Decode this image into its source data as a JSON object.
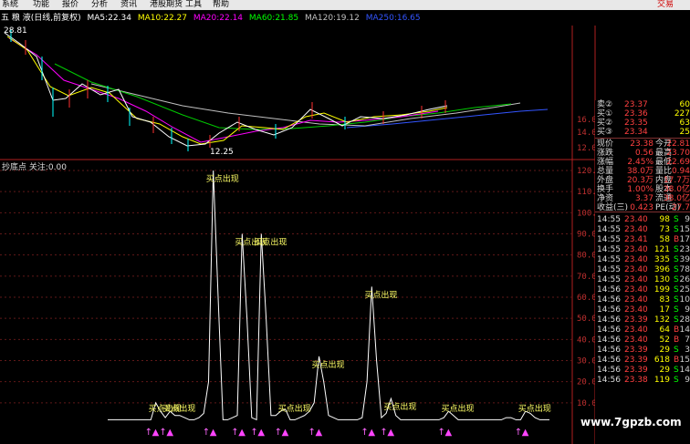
{
  "menu": {
    "items": [
      "系统",
      "功能",
      "报价",
      "分析",
      "资讯",
      "港股期货",
      "工具",
      "帮助"
    ],
    "trade": "交易"
  },
  "stock": {
    "title": "五 粮 液(日线,前复权)"
  },
  "ma_legend": [
    {
      "label": "MA5:22.34",
      "color": "#ffffff"
    },
    {
      "label": "MA10:22.27",
      "color": "#ffff00"
    },
    {
      "label": "MA20:22.14",
      "color": "#ff00ff"
    },
    {
      "label": "MA60:21.85",
      "color": "#00ff00"
    },
    {
      "label": "MA120:19.12",
      "color": "#c0c0c0"
    },
    {
      "label": "MA250:16.65",
      "color": "#3355ff"
    }
  ],
  "price_chart": {
    "high_label": "28.81",
    "low_label": "12.25",
    "ticks": [
      "16.00",
      "14.00",
      "12.00"
    ]
  },
  "indicator": {
    "title": "抄底点 关注:0.00",
    "ticks": [
      "120.00",
      "110.00",
      "100.00",
      "90.00",
      "80.00",
      "70.00",
      "60.00",
      "50.00",
      "40.00",
      "30.00",
      "20.00",
      "10.00"
    ],
    "signal_label": "买点出现",
    "chart_data": {
      "type": "line",
      "ylim": [
        0,
        120
      ],
      "series": [
        {
          "color": "#ffffff",
          "points": [
            [
              0,
              2
            ],
            [
              9,
              2
            ],
            [
              10,
              10
            ],
            [
              11,
              6
            ],
            [
              12,
              3
            ],
            [
              13,
              6
            ],
            [
              14,
              4
            ],
            [
              15,
              4
            ],
            [
              16,
              3
            ],
            [
              17,
              2
            ],
            [
              18,
              2
            ],
            [
              19,
              3
            ],
            [
              20,
              5
            ],
            [
              21,
              20
            ],
            [
              22,
              120
            ],
            [
              23,
              60
            ],
            [
              24,
              2
            ],
            [
              25,
              2
            ],
            [
              26,
              3
            ],
            [
              27,
              4
            ],
            [
              28,
              90
            ],
            [
              29,
              50
            ],
            [
              30,
              3
            ],
            [
              31,
              2
            ],
            [
              32,
              90
            ],
            [
              33,
              50
            ],
            [
              34,
              4
            ],
            [
              35,
              4
            ],
            [
              36,
              6
            ],
            [
              37,
              7
            ],
            [
              38,
              2
            ],
            [
              39,
              2
            ],
            [
              40,
              3
            ],
            [
              41,
              4
            ],
            [
              42,
              6
            ],
            [
              43,
              10
            ],
            [
              44,
              32
            ],
            [
              45,
              20
            ],
            [
              46,
              4
            ],
            [
              47,
              3
            ],
            [
              48,
              2
            ],
            [
              49,
              2
            ],
            [
              50,
              2
            ],
            [
              51,
              2
            ],
            [
              52,
              2
            ],
            [
              53,
              3
            ],
            [
              54,
              20
            ],
            [
              55,
              65
            ],
            [
              56,
              30
            ],
            [
              57,
              3
            ],
            [
              58,
              5
            ],
            [
              59,
              12
            ],
            [
              60,
              4
            ],
            [
              61,
              2
            ],
            [
              62,
              2
            ],
            [
              63,
              2
            ],
            [
              64,
              2
            ],
            [
              65,
              2
            ],
            [
              66,
              2
            ],
            [
              67,
              2
            ],
            [
              68,
              2
            ],
            [
              69,
              2
            ],
            [
              70,
              3
            ],
            [
              71,
              6
            ],
            [
              72,
              4
            ],
            [
              73,
              2
            ],
            [
              74,
              2
            ],
            [
              75,
              2
            ],
            [
              76,
              2
            ],
            [
              77,
              2
            ],
            [
              78,
              2
            ],
            [
              79,
              2
            ],
            [
              80,
              2
            ],
            [
              81,
              2
            ],
            [
              82,
              2
            ],
            [
              83,
              3
            ],
            [
              84,
              3
            ],
            [
              85,
              2
            ],
            [
              86,
              2
            ],
            [
              87,
              6
            ],
            [
              88,
              5
            ],
            [
              89,
              3
            ],
            [
              90,
              2
            ],
            [
              91,
              2
            ],
            [
              92,
              2
            ]
          ]
        }
      ]
    }
  },
  "quote": {
    "ask_rows": [
      {
        "label": "卖②",
        "price": "23.37",
        "vol": "60"
      },
      {
        "label": "买①",
        "price": "23.36",
        "vol": "227"
      },
      {
        "label": "买②",
        "price": "23.35",
        "vol": "63"
      },
      {
        "label": "买③",
        "price": "23.34",
        "vol": "25"
      }
    ],
    "stats": [
      {
        "l1": "现价",
        "v1": "23.38",
        "l2": "今开",
        "v2": "22.81"
      },
      {
        "l1": "涨跌",
        "v1": "0.56",
        "l2": "最高",
        "v2": "23.70"
      },
      {
        "l1": "涨幅",
        "v1": "2.45%",
        "l2": "最低",
        "v2": "22.69"
      },
      {
        "l1": "总量",
        "v1": "38.0万",
        "l2": "量比",
        "v2": "0.94"
      },
      {
        "l1": "外盘",
        "v1": "20.3万",
        "l2": "内盘",
        "v2": "17.7万"
      },
      {
        "l1": "换手",
        "v1": "1.00%",
        "l2": "股本",
        "v2": "38.0亿"
      },
      {
        "l1": "净资",
        "v1": "3.37",
        "l2": "流通",
        "v2": "38.0亿"
      },
      {
        "l1": "收益(三)",
        "v1": "0.423",
        "l2": "PE(动)",
        "v2": "27.7"
      }
    ],
    "ticks": [
      {
        "time": "14:55",
        "price": "23.40",
        "vol": "98",
        "side": "S",
        "n": "9"
      },
      {
        "time": "14:55",
        "price": "23.40",
        "vol": "73",
        "side": "S",
        "n": "15"
      },
      {
        "time": "14:55",
        "price": "23.41",
        "vol": "58",
        "side": "B",
        "n": "17"
      },
      {
        "time": "14:55",
        "price": "23.40",
        "vol": "121",
        "side": "S",
        "n": "23"
      },
      {
        "time": "14:55",
        "price": "23.40",
        "vol": "335",
        "side": "S",
        "n": "39"
      },
      {
        "time": "14:55",
        "price": "23.40",
        "vol": "396",
        "side": "S",
        "n": "78"
      },
      {
        "time": "14:55",
        "price": "23.40",
        "vol": "130",
        "side": "S",
        "n": "26"
      },
      {
        "time": "14:56",
        "price": "23.40",
        "vol": "199",
        "side": "S",
        "n": "25"
      },
      {
        "time": "14:56",
        "price": "23.40",
        "vol": "83",
        "side": "S",
        "n": "10"
      },
      {
        "time": "14:56",
        "price": "23.40",
        "vol": "17",
        "side": "S",
        "n": "9"
      },
      {
        "time": "14:56",
        "price": "23.39",
        "vol": "132",
        "side": "S",
        "n": "28"
      },
      {
        "time": "14:56",
        "price": "23.40",
        "vol": "64",
        "side": "B",
        "n": "14"
      },
      {
        "time": "14:56",
        "price": "23.40",
        "vol": "52",
        "side": "B",
        "n": "7"
      },
      {
        "time": "14:56",
        "price": "23.39",
        "vol": "29",
        "side": "S",
        "n": "3"
      },
      {
        "time": "14:56",
        "price": "23.39",
        "vol": "618",
        "side": "B",
        "n": "15"
      },
      {
        "time": "14:56",
        "price": "23.39",
        "vol": "29",
        "side": "S",
        "n": "14"
      },
      {
        "time": "14:56",
        "price": "23.38",
        "vol": "119",
        "side": "S",
        "n": "9"
      }
    ]
  },
  "watermark": "www.7gpzb.com"
}
